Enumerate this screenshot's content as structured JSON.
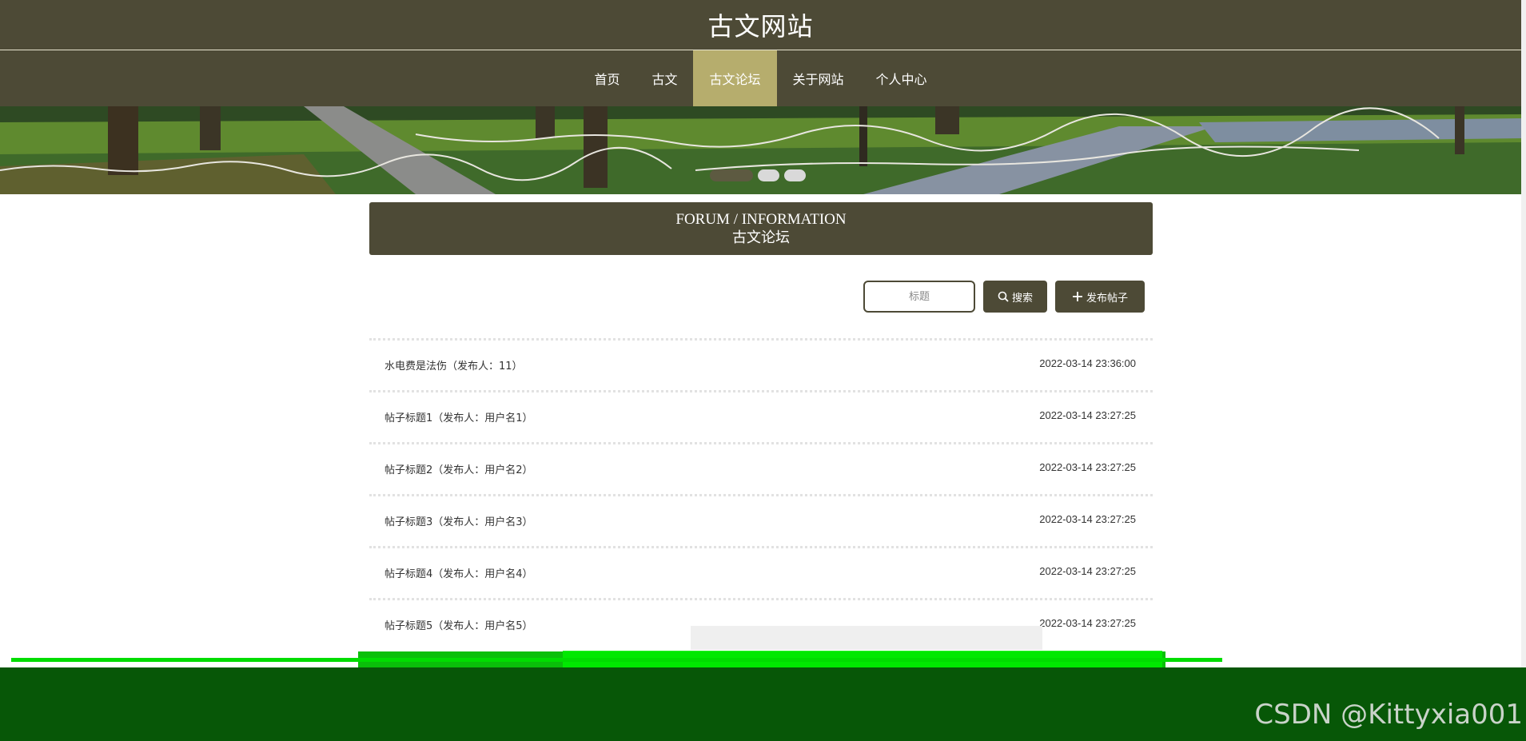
{
  "site": {
    "title": "古文网站"
  },
  "nav": {
    "items": [
      {
        "label": "首页"
      },
      {
        "label": "古文"
      },
      {
        "label": "古文论坛",
        "active": true
      },
      {
        "label": "关于网站"
      },
      {
        "label": "个人中心"
      }
    ]
  },
  "banner": {
    "slide_count": 3,
    "active_slide": 1
  },
  "forum": {
    "title_en": "FORUM / INFORMATION",
    "title_cn": "古文论坛"
  },
  "search": {
    "placeholder": "标题",
    "value": "",
    "button_label": "搜索"
  },
  "post_button": {
    "label": "发布帖子"
  },
  "posts": [
    {
      "title": "水电费是法伤（发布人：11）",
      "time": "2022-03-14 23:36:00"
    },
    {
      "title": "帖子标题1（发布人：用户名1）",
      "time": "2022-03-14 23:27:25"
    },
    {
      "title": "帖子标题2（发布人：用户名2）",
      "time": "2022-03-14 23:27:25"
    },
    {
      "title": "帖子标题3（发布人：用户名3）",
      "time": "2022-03-14 23:27:25"
    },
    {
      "title": "帖子标题4（发布人：用户名4）",
      "time": "2022-03-14 23:27:25"
    },
    {
      "title": "帖子标题5（发布人：用户名5）",
      "time": "2022-03-14 23:27:25"
    }
  ],
  "watermark": "CSDN @Kittyxia001",
  "colors": {
    "header_bg": "#4d4a36",
    "nav_active": "#b6ad6d",
    "footer_glitch": "#075707"
  },
  "icons": {
    "search": "search-icon",
    "post": "plus-icon"
  }
}
